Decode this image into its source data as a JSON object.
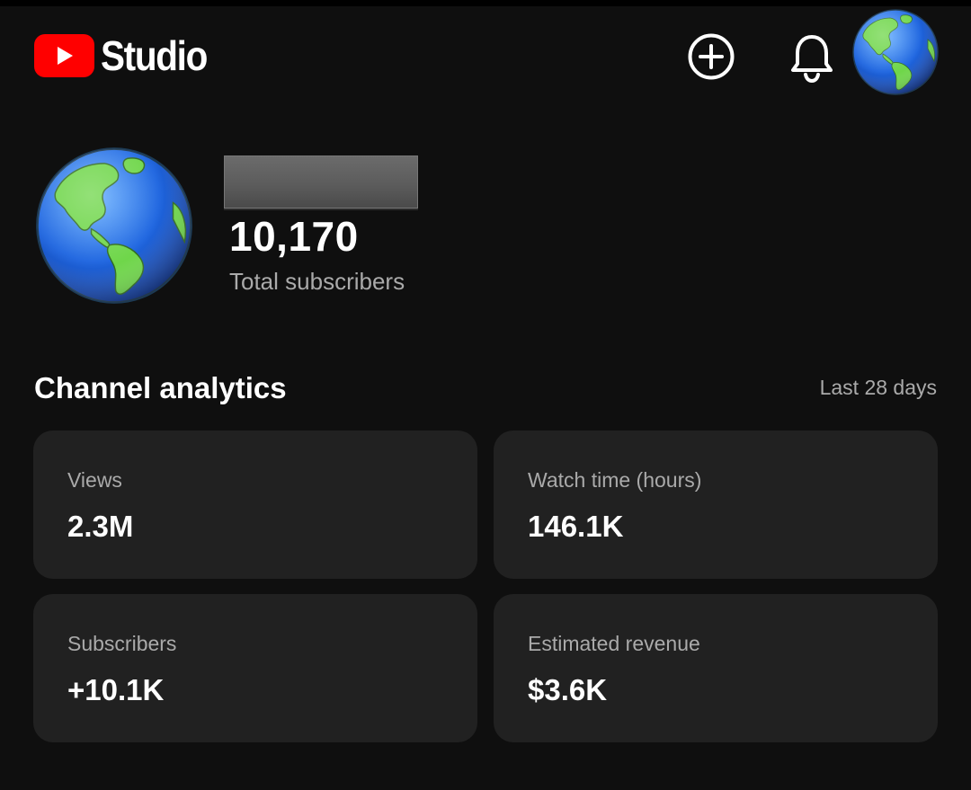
{
  "header": {
    "app_name": "Studio",
    "brand_color": "#ff0000",
    "icons": [
      "youtube-play-icon",
      "create-plus-icon",
      "bell-icon",
      "globe-avatar-icon"
    ]
  },
  "channel": {
    "subscriber_count": "10,170",
    "subscriber_label": "Total subscribers"
  },
  "analytics": {
    "title": "Channel analytics",
    "range": "Last 28 days",
    "cards": [
      {
        "label": "Views",
        "value": "2.3M"
      },
      {
        "label": "Watch time (hours)",
        "value": "146.1K"
      },
      {
        "label": "Subscribers",
        "value": "+10.1K"
      },
      {
        "label": "Estimated revenue",
        "value": "$3.6K"
      }
    ]
  }
}
